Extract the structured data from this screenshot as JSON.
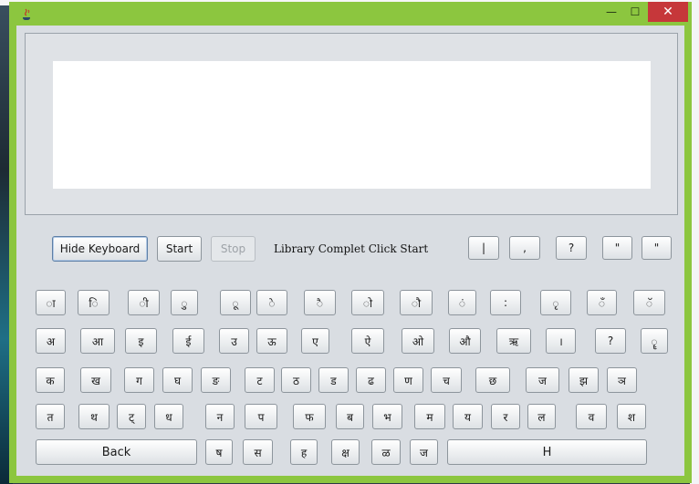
{
  "window": {
    "title_icon": "java-cup-icon",
    "controls": {
      "minimize": "—",
      "maximize": "☐",
      "close": "✕"
    }
  },
  "editor": {
    "value": ""
  },
  "controls": {
    "hide_keyboard": "Hide Keyboard",
    "start": "Start",
    "stop": "Stop",
    "status": "Library Complet Click Start"
  },
  "punctuation": [
    "|",
    ",",
    "?",
    "\"",
    "\""
  ],
  "keyboard": {
    "row1": [
      "ा",
      "ि",
      "ी",
      "ु",
      "ू",
      "े",
      "ै",
      "ो",
      "ौ",
      "ं",
      ":",
      "ृ",
      "ँ",
      "ॅ"
    ],
    "row2": [
      "अ",
      "आ",
      "इ",
      "ई",
      "उ",
      "ऊ",
      "ए",
      "ऐ",
      "ओ",
      "औ",
      "ऋ",
      "।",
      "?",
      "ॄ"
    ],
    "row3": [
      "क",
      "ख",
      "ग",
      "घ",
      "ङ",
      "ट",
      "ठ",
      "ड",
      "ढ",
      "ण",
      "च",
      "छ",
      "ज",
      "झ",
      "ञ"
    ],
    "row4": [
      "त",
      "थ",
      "ट्",
      "ध",
      "न",
      "प",
      "फ",
      "ब",
      "भ",
      "म",
      "य",
      "र",
      "ल",
      "व",
      "श"
    ],
    "row5": [
      "Back",
      "ष",
      "स",
      "ह",
      "क्ष",
      "ळ",
      "ज",
      "H"
    ]
  }
}
